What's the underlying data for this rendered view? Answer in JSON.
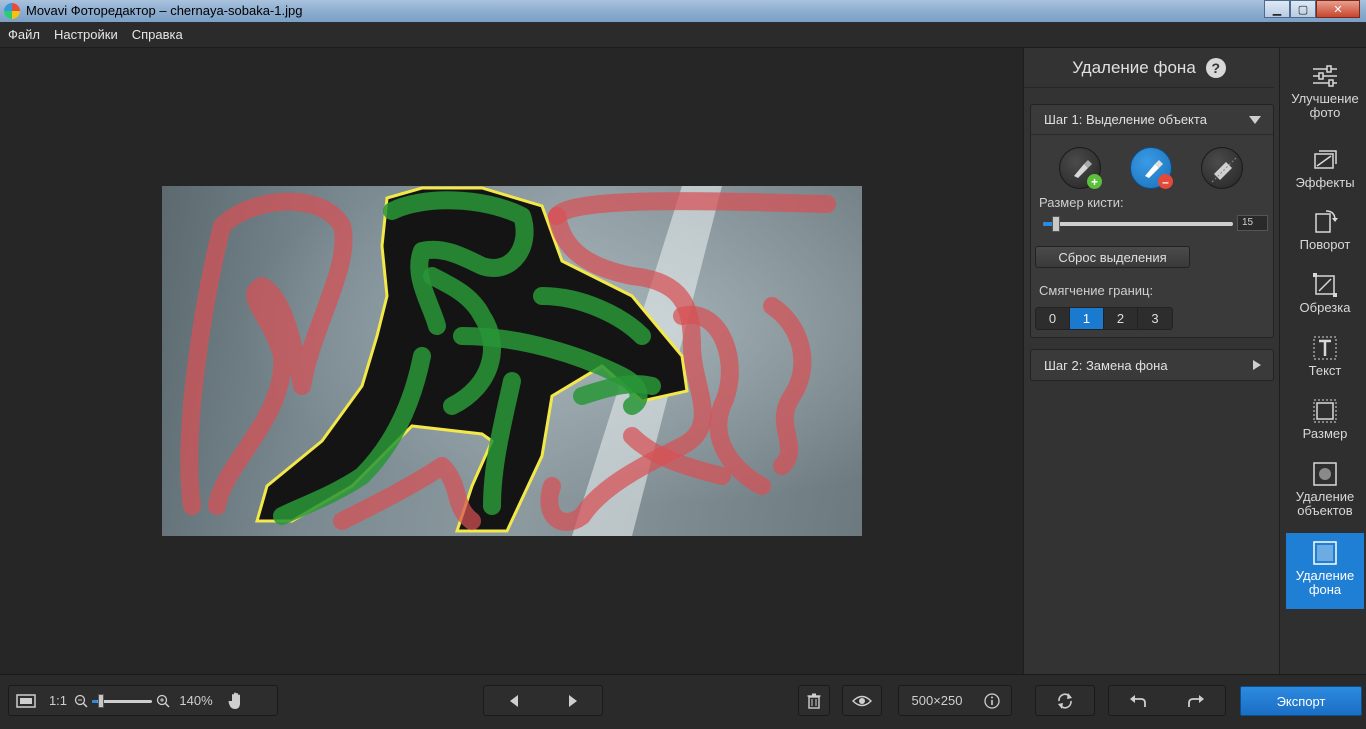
{
  "window": {
    "title": "Movavi Фоторедактор – chernaya-sobaka-1.jpg"
  },
  "menu": {
    "items": [
      "Файл",
      "Настройки",
      "Справка"
    ]
  },
  "panel": {
    "title": "Удаление фона",
    "step1": {
      "label": "Шаг 1: Выделение объекта",
      "brush_size_label": "Размер кисти:",
      "brush_size_value": "15",
      "brush_size_level": 0.07,
      "reset_button": "Сброс выделения",
      "smoothing_label": "Смягчение границ:",
      "smoothing_options": [
        "0",
        "1",
        "2",
        "3"
      ],
      "smoothing_selected": "1"
    },
    "step2": {
      "label": "Шаг 2: Замена фона"
    }
  },
  "toolbar": {
    "items": [
      {
        "label_line1": "Улучшение",
        "label_line2": "фото",
        "icon": "sliders-icon"
      },
      {
        "label_line1": "Эффекты",
        "label_line2": "",
        "icon": "effects-icon"
      },
      {
        "label_line1": "Поворот",
        "label_line2": "",
        "icon": "rotate-icon"
      },
      {
        "label_line1": "Обрезка",
        "label_line2": "",
        "icon": "crop-icon"
      },
      {
        "label_line1": "Текст",
        "label_line2": "",
        "icon": "text-icon"
      },
      {
        "label_line1": "Размер",
        "label_line2": "",
        "icon": "resize-icon"
      },
      {
        "label_line1": "Удаление",
        "label_line2": "объектов",
        "icon": "object-removal-icon"
      },
      {
        "label_line1": "Удаление",
        "label_line2": "фона",
        "icon": "background-removal-icon"
      }
    ]
  },
  "bottom": {
    "one_to_one": "1:1",
    "zoom": "140%",
    "zoom_level": 0.1,
    "image_size": "500×250",
    "export_label": "Экспорт"
  },
  "colors": {
    "accent": "#1f7fd4",
    "selection_green": "#2a9a3a",
    "background_red": "#d8555a",
    "outline_yellow": "#f2e84a"
  }
}
